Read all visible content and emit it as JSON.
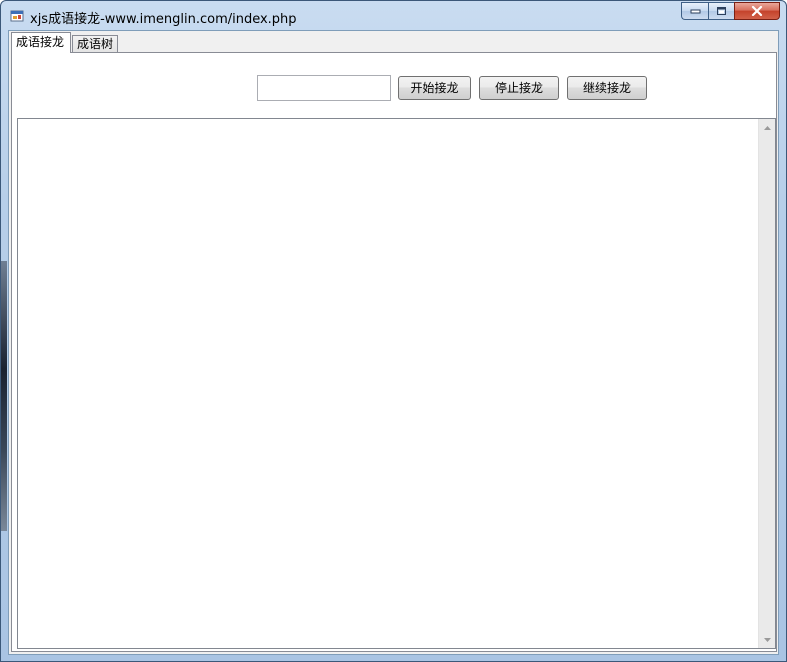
{
  "window": {
    "title": "xjs成语接龙-www.imenglin.com/index.php",
    "app_icon": "app-window-icon",
    "caption_buttons": [
      "minimize-icon",
      "maximize-icon",
      "close-icon"
    ]
  },
  "tabs": [
    {
      "label": "成语接龙",
      "selected": true
    },
    {
      "label": "成语树",
      "selected": false
    }
  ],
  "controls": {
    "input_value": "",
    "start_label": "开始接龙",
    "stop_label": "停止接龙",
    "continue_label": "继续接龙"
  },
  "output": {
    "text": ""
  },
  "colors": {
    "title_bar": "#b7cfe9",
    "close_button": "#c4422b",
    "client_background": "#f0f0f0"
  }
}
